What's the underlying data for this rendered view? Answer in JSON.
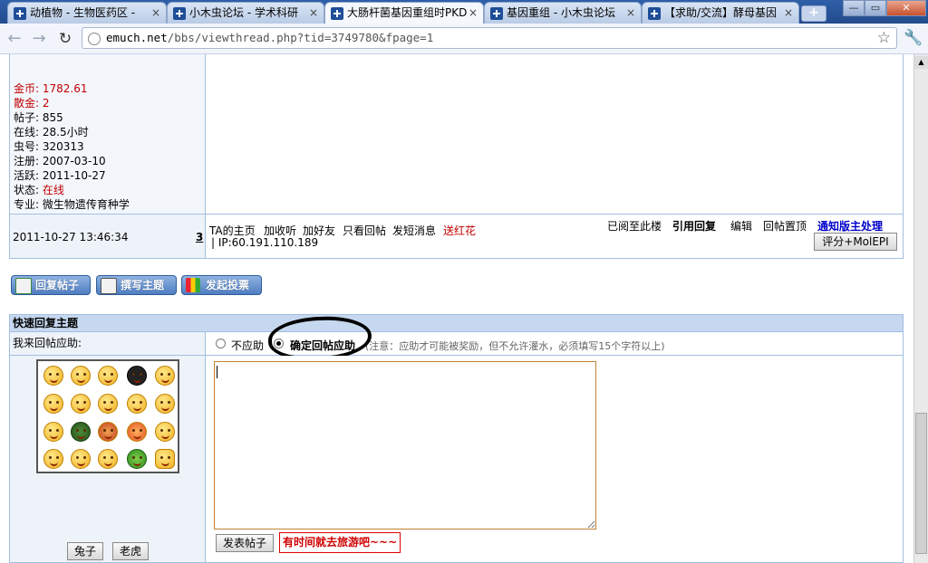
{
  "browser": {
    "tabs": [
      {
        "label": "动植物 - 生物医药区 -",
        "active": false
      },
      {
        "label": "小木虫论坛 - 学术科研",
        "active": false
      },
      {
        "label": "大肠杆菌基因重组时PKD",
        "active": true
      },
      {
        "label": "基因重组 - 小木虫论坛",
        "active": false
      },
      {
        "label": "【求助/交流】酵母基因",
        "active": false
      }
    ],
    "tab_close_glyph": "×",
    "new_tab_glyph": "+",
    "window_controls": {
      "minimize": "—",
      "maximize": "▭",
      "close": "✕"
    },
    "nav": {
      "back": "←",
      "forward": "→",
      "reload": "↻"
    },
    "url_host": "emuch.net",
    "url_path": "/bbs/viewthread.php?tid=3749780&fpage=1",
    "star_glyph": "☆",
    "wrench_glyph": "🔧"
  },
  "profile": {
    "stats": [
      {
        "label": "金币:",
        "value": "1782.61",
        "red": true
      },
      {
        "label": "散金:",
        "value": "2",
        "red": true
      },
      {
        "label": "帖子:",
        "value": "855",
        "red": false
      },
      {
        "label": "在线:",
        "value": "28.5小时",
        "red": false
      },
      {
        "label": "虫号:",
        "value": "320313",
        "red": false
      },
      {
        "label": "注册:",
        "value": "2007-03-10",
        "red": false
      },
      {
        "label": "活跃:",
        "value": "2011-10-27",
        "red": false
      },
      {
        "label": "状态:",
        "value": "在线",
        "red": false,
        "value_red": true
      },
      {
        "label": "专业:",
        "value": "微生物遗传育种学",
        "red": false
      }
    ]
  },
  "post_footer": {
    "date": "2011-10-27 13:46:34",
    "floor": "3",
    "left_links": [
      "TA的主页",
      "加收听",
      "加好友",
      "只看回帖",
      "发短消息"
    ],
    "flower_link": "送红花",
    "ip": "| IP:60.191.110.189",
    "read_here": "已阅至此楼",
    "quote_reply": "引用回复",
    "edit": "编辑",
    "pin_reply": "回帖置顶",
    "notify_mod": "通知版主处理",
    "rate_button": "评分+MolEPI"
  },
  "action_buttons": {
    "reply": "回复帖子",
    "new_topic": "撰写主题",
    "poll": "发起投票"
  },
  "quick_reply": {
    "header": "快速回复主题",
    "reward_label": "我来回帖应助:",
    "opt_none": "不应助",
    "opt_confirm": "确定回帖应助",
    "notice": "(注意：应助才可能被奖励，但不允许灌水，必须填写15个字符以上)",
    "buttons": {
      "rabbit": "兔子",
      "tiger": "老虎"
    },
    "submit": "发表帖子",
    "slogan": "有时间就去旅游吧~~~"
  }
}
